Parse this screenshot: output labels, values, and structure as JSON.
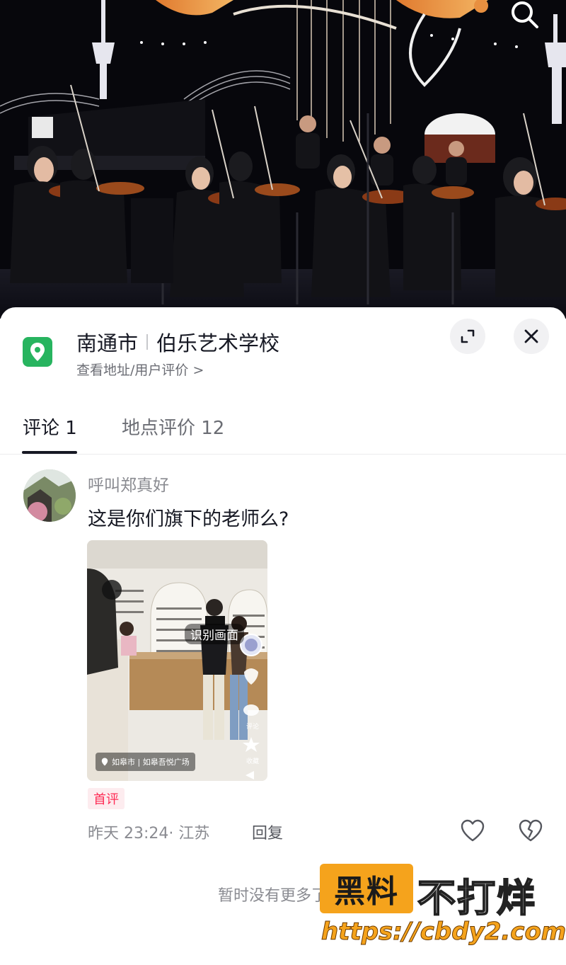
{
  "location": {
    "city": "南通市",
    "place_name": "伯乐艺术学校",
    "subtitle": "查看地址/用户评价 >"
  },
  "tabs": [
    {
      "label": "评论 1",
      "active": true
    },
    {
      "label": "地点评价 12",
      "active": false
    }
  ],
  "comment": {
    "username": "呼叫郑真好",
    "text": "这是你们旗下的老师么?",
    "image": {
      "tag": "识别画面",
      "location_tag": "如皋市 | 如皋吾悦广场",
      "side_labels": [
        "评论",
        "收藏"
      ]
    },
    "badge": "首评",
    "time_location": "昨天 23:24· 江苏",
    "reply_label": "回复"
  },
  "footer": {
    "no_more": "暂时没有更多了"
  },
  "watermark": {
    "badge": "黑料",
    "text": "不打烊",
    "url": "https://cbdy2.com"
  },
  "icons": {
    "search": "search-icon",
    "pin": "location-pin-icon",
    "expand": "expand-icon",
    "close": "close-icon",
    "like": "heart-icon",
    "dislike": "broken-heart-icon"
  },
  "colors": {
    "pin_green": "#27b45f",
    "badge_red": "#fe2c55",
    "watermark_orange": "#f5a31c"
  }
}
